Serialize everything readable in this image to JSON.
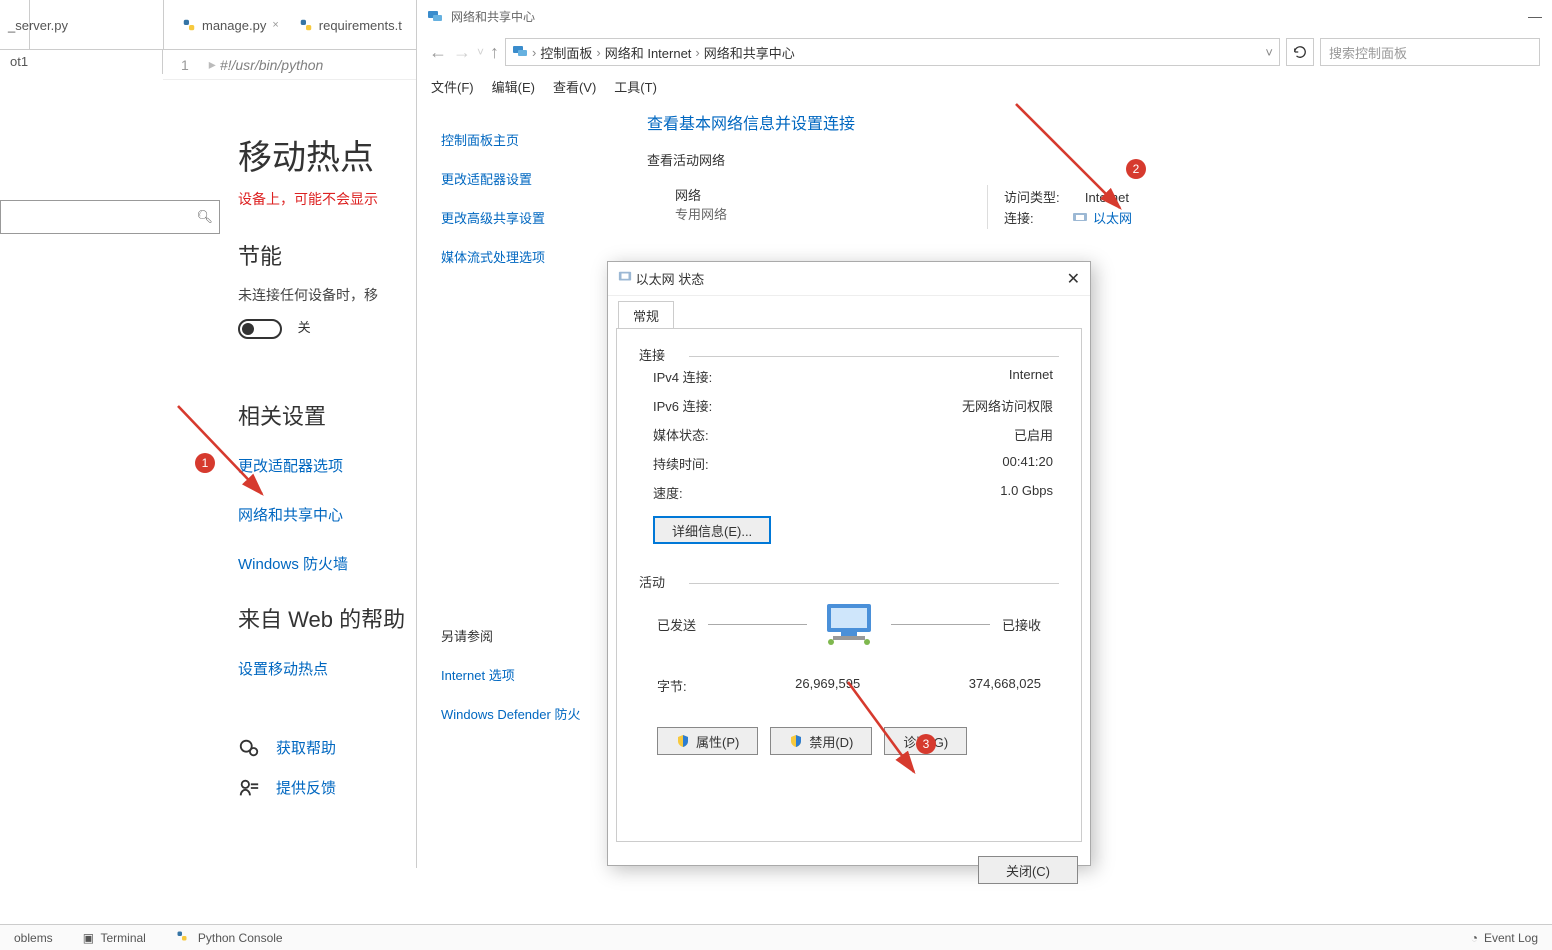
{
  "ide": {
    "tabs": [
      {
        "label": "_server.py"
      },
      {
        "label": "manage.py"
      },
      {
        "label": "requirements.t"
      }
    ],
    "tree_item": "ot1",
    "editor": {
      "line_no": "1",
      "shebang": "#!/usr/bin/python"
    },
    "toolbar_icons": [
      "target-icon",
      "sort-icon",
      "gear-icon",
      "collapse-icon"
    ],
    "bottom": {
      "problems": "oblems",
      "terminal": "Terminal",
      "pyconsole": "Python Console",
      "eventlog": "Event Log"
    }
  },
  "settings": {
    "title": "移动热点",
    "warning": "设备上，可能不会显示",
    "section_power": "节能",
    "power_desc": "未连接任何设备时，移",
    "toggle_label": "关",
    "section_related": "相关设置",
    "links": {
      "adapter": "更改适配器选项",
      "sharing_center": "网络和共享中心",
      "firewall": "Windows 防火墙"
    },
    "section_web": "来自 Web 的帮助",
    "web_link": "设置移动热点",
    "help": "获取帮助",
    "feedback": "提供反馈",
    "search_placeholder": ""
  },
  "ncwin": {
    "title": "网络和共享中心",
    "breadcrumb": [
      "控制面板",
      "网络和 Internet",
      "网络和共享中心"
    ],
    "search_placeholder": "搜索控制面板",
    "menubar": [
      "文件(F)",
      "编辑(E)",
      "查看(V)",
      "工具(T)"
    ],
    "sidebar": {
      "home": "控制面板主页",
      "adapter": "更改适配器设置",
      "advanced": "更改高级共享设置",
      "media": "媒体流式处理选项",
      "see_also": "另请参阅",
      "inetopt": "Internet 选项",
      "defender": "Windows Defender 防火"
    },
    "main": {
      "headline": "查看基本网络信息并设置连接",
      "active_label": "查看活动网络",
      "net_name": "网络",
      "net_type": "专用网络",
      "access_label": "访问类型:",
      "access_value": "Internet",
      "conn_label": "连接:",
      "conn_value": "以太网"
    }
  },
  "dlg": {
    "title": "以太网 状态",
    "tab": "常规",
    "group_conn": "连接",
    "kv": {
      "ipv4_l": "IPv4 连接:",
      "ipv4_v": "Internet",
      "ipv6_l": "IPv6 连接:",
      "ipv6_v": "无网络访问权限",
      "media_l": "媒体状态:",
      "media_v": "已启用",
      "duration_l": "持续时间:",
      "duration_v": "00:41:20",
      "speed_l": "速度:",
      "speed_v": "1.0 Gbps"
    },
    "details_btn": "详细信息(E)...",
    "group_activity": "活动",
    "sent_label": "已发送",
    "recv_label": "已接收",
    "bytes_label": "字节:",
    "bytes_sent": "26,969,595",
    "bytes_recv": "374,668,025",
    "btn_props": "属性(P)",
    "btn_disable": "禁用(D)",
    "btn_diag": "诊断(G)",
    "btn_close": "关闭(C)"
  },
  "annotations": {
    "b1": "1",
    "b2": "2",
    "b3": "3"
  }
}
